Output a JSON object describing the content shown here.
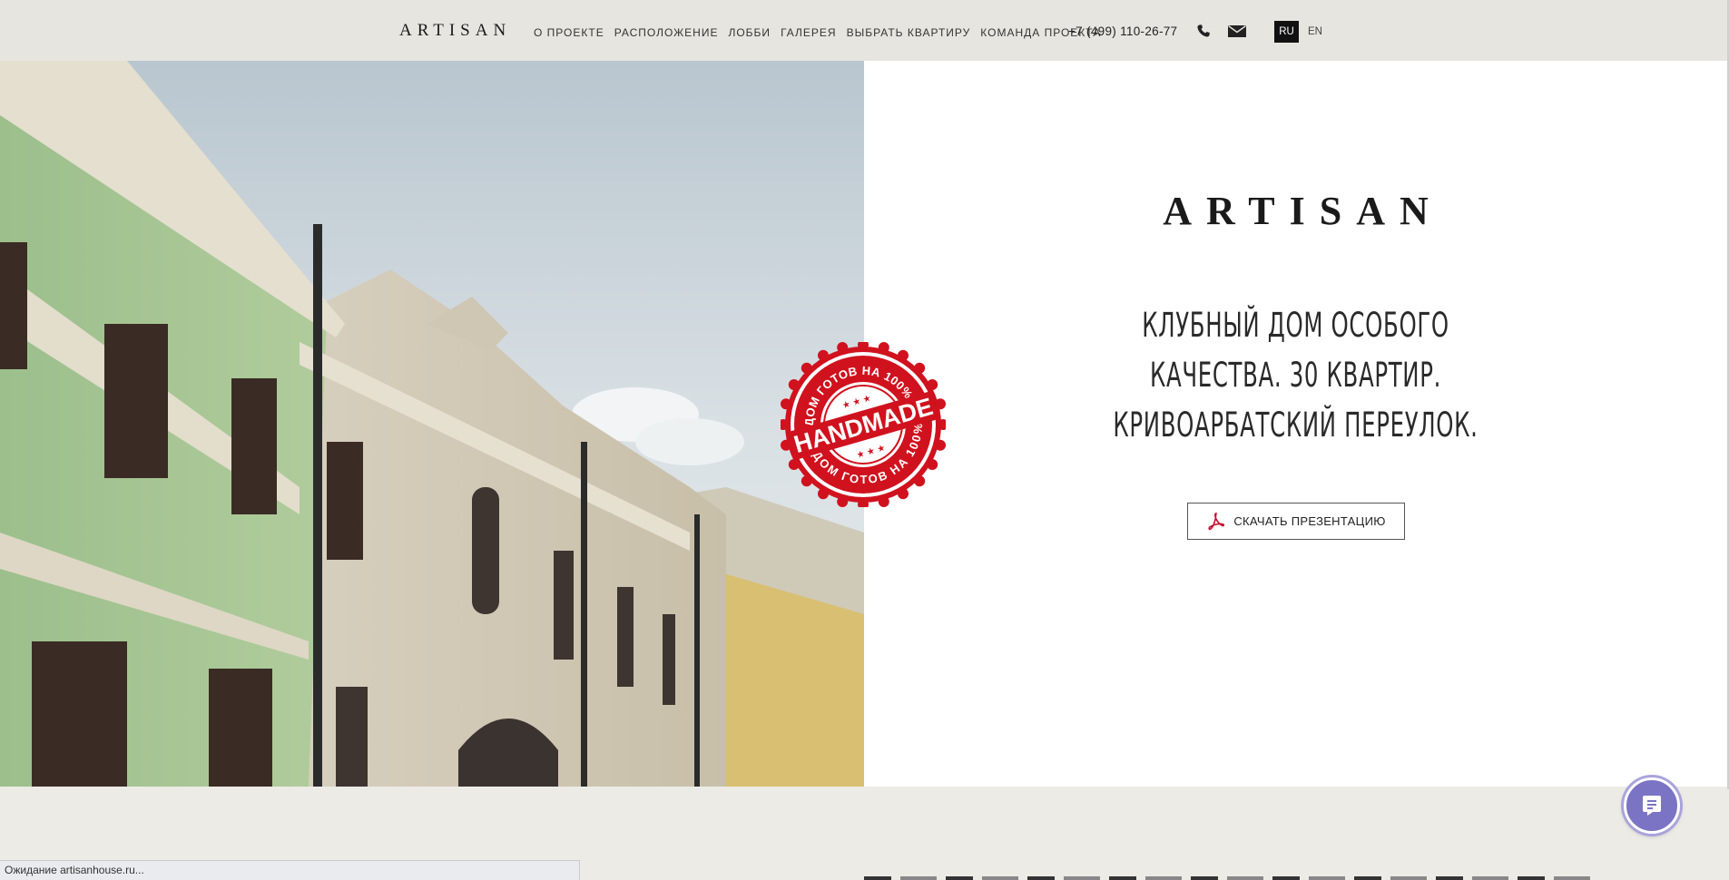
{
  "header": {
    "logo": "ARTISAN",
    "nav": [
      "О ПРОЕКТЕ",
      "РАСПОЛОЖЕНИЕ",
      "ЛОББИ",
      "ГАЛЕРЕЯ",
      "ВЫБРАТЬ КВАРТИРУ",
      "КОМАНДА ПРОЕКТА"
    ],
    "phone": "+7 (499) 110-26-77",
    "icons": [
      "phone-icon",
      "mail-icon"
    ],
    "languages": [
      {
        "code": "RU",
        "active": true
      },
      {
        "code": "EN",
        "active": false
      }
    ]
  },
  "hero": {
    "logo": "ARTISAN",
    "tagline": [
      "КЛУБНЫЙ ДОМ ОСОБОГО",
      "КАЧЕСТВА. 30 КВАРТИР.",
      "КРИВОАРБАТСКИЙ ПЕРЕУЛОК."
    ],
    "button_label": "СКАЧАТЬ ПРЕЗЕНТАЦИЮ",
    "button_icon": "pdf-icon",
    "stamp": {
      "main": "HANDMADE",
      "top_arc": "ДОМ ГОТОВ НА 100%",
      "bottom_arc": "ДОМ ГОТОВ НА 100%"
    }
  },
  "chat_icon": "chat-icon",
  "status_bar": "Ожидание artisanhouse.ru...",
  "colors": {
    "header_bg": "#e7e5df",
    "page_bg": "#ecebe6",
    "stamp_red": "#d0121e",
    "chat_purple": "#7b73c4",
    "pdf_red": "#c8102e"
  }
}
